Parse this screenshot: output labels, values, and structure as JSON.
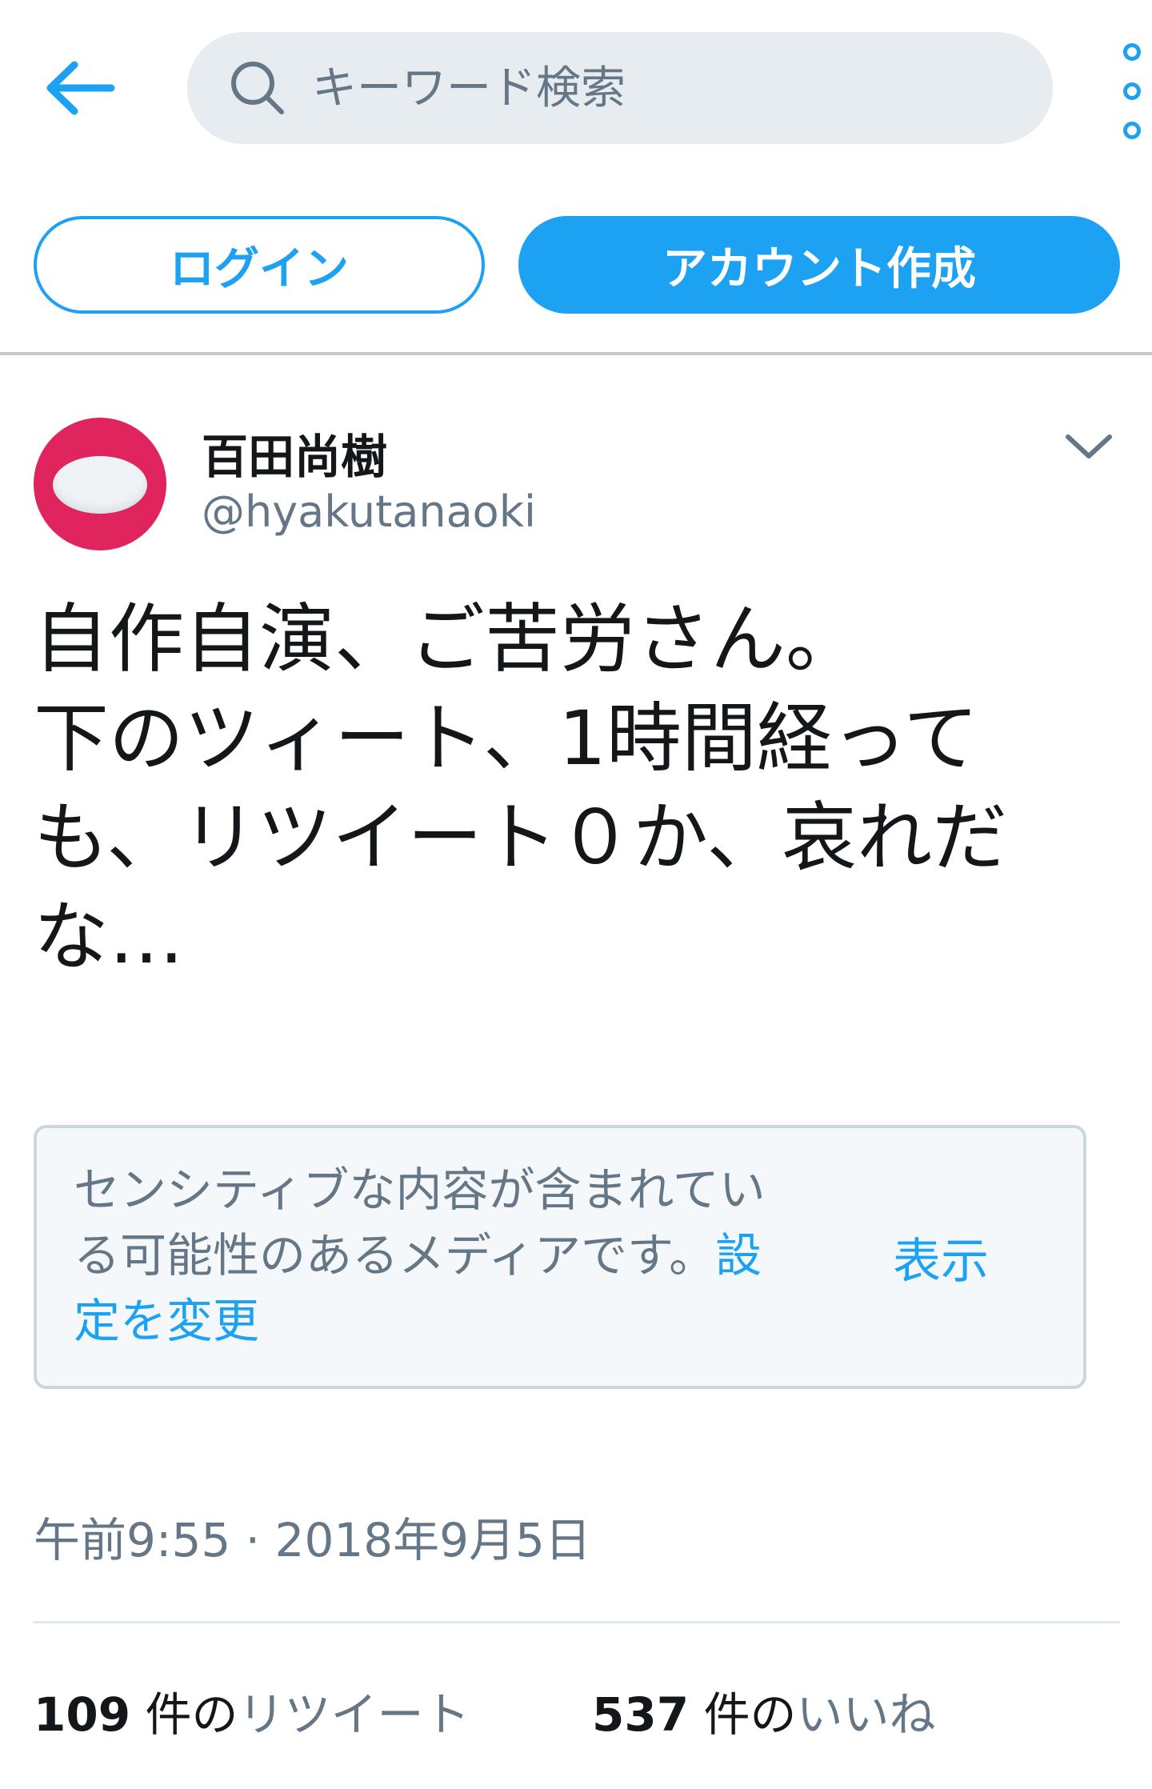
{
  "search": {
    "placeholder": "キーワード検索"
  },
  "auth": {
    "login_label": "ログイン",
    "signup_label": "アカウント作成"
  },
  "tweet": {
    "author_name": "百田尚樹",
    "author_handle": "@hyakutanaoki",
    "text": "自作自演、ご苦労さん。\n下のツィート、1時間経って\nも、リツイート０か、哀れだ\nな…",
    "sensitive_media": {
      "notice": "センシティブな内容が含まれている可能性のあるメディアです。",
      "settings_link": "設定を変更",
      "show_label": "表示"
    },
    "timestamp": "午前9:55 · 2018年9月5日",
    "stats": {
      "retweets_count": "109",
      "retweets_unit": "件の",
      "retweets_label": "リツイート",
      "likes_count": "537",
      "likes_unit": "件の",
      "likes_label": "いいね"
    }
  },
  "colors": {
    "accent": "#1da1f2",
    "avatar_bg": "#e0245e",
    "secondary_text": "#657786"
  },
  "icons": {
    "back": "arrow-left-icon",
    "search": "search-icon",
    "more": "more-vertical-icon",
    "caret": "chevron-down-icon"
  }
}
